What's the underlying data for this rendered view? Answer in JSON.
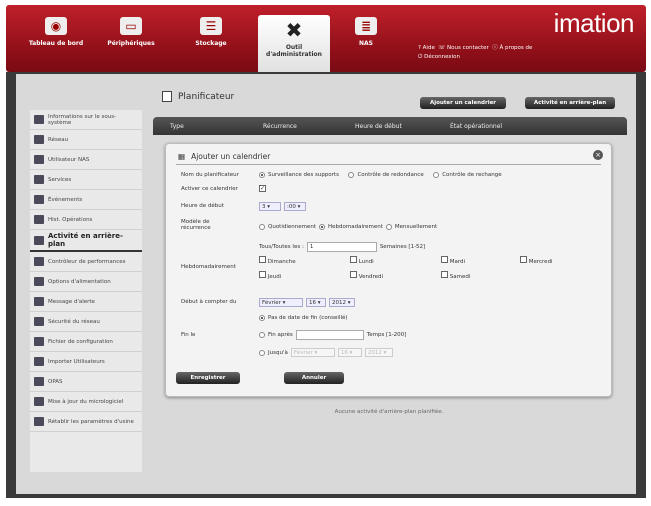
{
  "header": {
    "brand": "imation",
    "nav": [
      {
        "label": "Tableau de bord",
        "icon": "dashboard-icon"
      },
      {
        "label": "Périphériques",
        "icon": "device-icon"
      },
      {
        "label": "Stockage",
        "icon": "storage-icon"
      },
      {
        "label": "Outil d'administration",
        "icon": "tools-icon",
        "active": true
      },
      {
        "label": "NAS",
        "icon": "server-icon"
      }
    ],
    "links": {
      "help": "Aide",
      "contact": "Nous contacter",
      "about": "À propos de",
      "logout": "Déconnexion"
    }
  },
  "sidebar": {
    "items": [
      {
        "label": "Informations sur le sous-système"
      },
      {
        "label": "Réseau"
      },
      {
        "label": "Utilisateur NAS"
      },
      {
        "label": "Services"
      },
      {
        "label": "Événements"
      },
      {
        "label": "Hist. Opérations"
      },
      {
        "label": "Activité en arrière-plan",
        "active": true
      },
      {
        "label": "Contrôleur de performances"
      },
      {
        "label": "Options d'alimentation"
      },
      {
        "label": "Message d'alerte"
      },
      {
        "label": "Sécurité du réseau"
      },
      {
        "label": "Fichier de configuration"
      },
      {
        "label": "Importer Utilisateurs"
      },
      {
        "label": "OPAS"
      },
      {
        "label": "Mise à jour du micrologiciel"
      },
      {
        "label": "Rétablir les paramètres d'usine"
      }
    ]
  },
  "main": {
    "title": "Planificateur",
    "add_calendar": "Ajouter un calendrier",
    "background_activity": "Activité en arrière-plan",
    "columns": [
      "Type",
      "Récurrence",
      "Heure de début",
      "État opérationnel"
    ],
    "empty": "Aucune activité d'arrière-plan planifiée."
  },
  "dialog": {
    "title": "Ajouter un calendrier",
    "scheduler_name_label": "Nom du planificateur",
    "scheduler_options": [
      "Surveillance des supports",
      "Contrôle de redondance",
      "Contrôle de rechange"
    ],
    "enable_label": "Activer ce calendrier",
    "start_time_label": "Heure de début",
    "hour": "3",
    "minute": ":00",
    "recurrence_label": "Modèle de récurrence",
    "recurrence_options": [
      "Quotidiennement",
      "Hebdomadairement",
      "Mensuellement"
    ],
    "weekly_label": "Hebdomadairement",
    "every_prefix": "Tous/Toutes les :",
    "every_value": "1",
    "every_suffix": "Semaines [1-52]",
    "days": [
      "Dimanche",
      "Lundi",
      "Mardi",
      "Mercredi",
      "Jeudi",
      "Vendredi",
      "Samedi"
    ],
    "start_from_label": "Début à compter du",
    "start_month": "Février",
    "start_day": "16",
    "start_year": "2012",
    "end_label": "Fin le",
    "no_end": "Pas de date de fin (conseillé)",
    "end_after": "Fin après",
    "end_after_suffix": "Temps [1-200]",
    "until": "Jusqu'à",
    "until_month": "Février",
    "until_day": "16",
    "until_year": "2012",
    "save": "Enregistrer",
    "cancel": "Annuler"
  }
}
